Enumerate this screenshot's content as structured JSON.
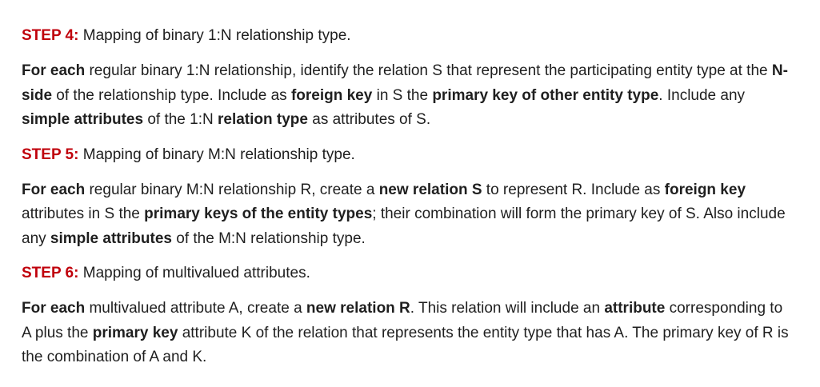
{
  "sections": [
    {
      "step_label": "STEP 4:",
      "step_title": " Mapping of binary 1:N relationship type.",
      "paragraph": [
        {
          "t": "For each",
          "b": true
        },
        {
          "t": " regular binary 1:N relationship, identify the relation S that represent the participating entity type at the ",
          "b": false
        },
        {
          "t": "N-side",
          "b": true
        },
        {
          "t": " of the relationship type. Include as ",
          "b": false
        },
        {
          "t": "foreign key",
          "b": true
        },
        {
          "t": " in S the ",
          "b": false
        },
        {
          "t": "primary key of other entity type",
          "b": true
        },
        {
          "t": ". Include any ",
          "b": false
        },
        {
          "t": "simple attributes",
          "b": true
        },
        {
          "t": " of the 1:N ",
          "b": false
        },
        {
          "t": "relation type",
          "b": true
        },
        {
          "t": " as attributes of S.",
          "b": false
        }
      ]
    },
    {
      "step_label": "STEP 5:",
      "step_title": " Mapping of binary M:N relationship type.",
      "paragraph": [
        {
          "t": "For each",
          "b": true
        },
        {
          "t": " regular binary M:N relationship R, create a ",
          "b": false
        },
        {
          "t": "new relation S",
          "b": true
        },
        {
          "t": " to represent R. Include as ",
          "b": false
        },
        {
          "t": "foreign key",
          "b": true
        },
        {
          "t": " attributes in S the ",
          "b": false
        },
        {
          "t": "primary keys of the entity types",
          "b": true
        },
        {
          "t": "; their combination will form the primary key of S. Also include any ",
          "b": false
        },
        {
          "t": "simple attributes",
          "b": true
        },
        {
          "t": " of the M:N relationship type.",
          "b": false
        }
      ]
    },
    {
      "step_label": "STEP 6:",
      "step_title": " Mapping of multivalued attributes.",
      "paragraph": [
        {
          "t": "For each",
          "b": true
        },
        {
          "t": " multivalued attribute A, create a ",
          "b": false
        },
        {
          "t": "new relation R",
          "b": true
        },
        {
          "t": ". This relation will include an ",
          "b": false
        },
        {
          "t": "attribute",
          "b": true
        },
        {
          "t": " corresponding to A plus the ",
          "b": false
        },
        {
          "t": "primary key",
          "b": true
        },
        {
          "t": " attribute K of the relation that represents the entity type that has A. The primary key of R is the combination of A and K.",
          "b": false
        }
      ]
    }
  ],
  "colors": {
    "step_label": "#c0000b",
    "text": "#1f1f1f",
    "background": "#ffffff"
  }
}
